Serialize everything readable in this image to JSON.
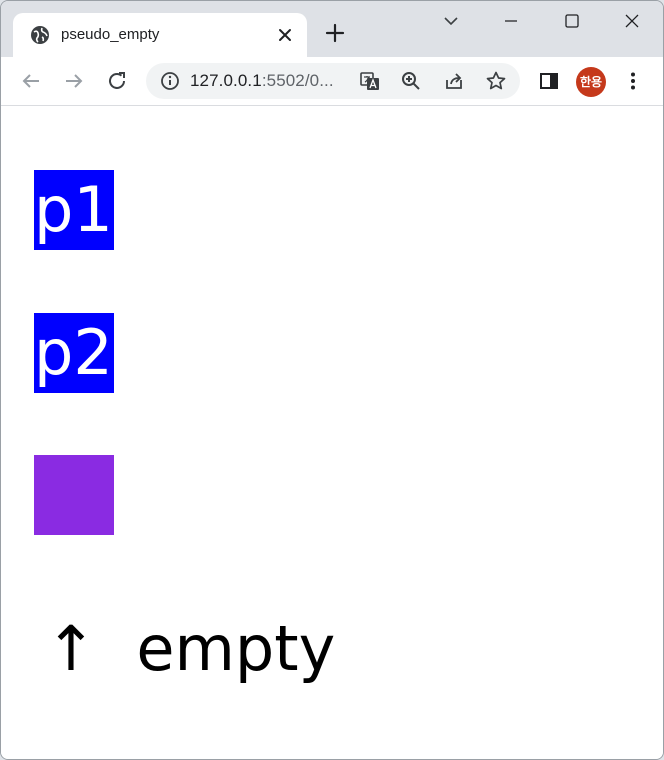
{
  "browser": {
    "tab": {
      "title": "pseudo_empty",
      "favicon": "globe-icon"
    },
    "address": {
      "host": "127.0.0.1",
      "rest": ":5502/0..."
    },
    "profile_label": "한용",
    "icons": {
      "back": "back-arrow-icon",
      "forward": "forward-arrow-icon",
      "reload": "reload-icon",
      "info": "info-icon",
      "translate": "translate-icon",
      "zoom": "zoom-in-icon",
      "share": "share-icon",
      "bookmark": "star-icon",
      "sidepanel": "side-panel-icon",
      "menu": "more-vert-icon"
    }
  },
  "page": {
    "paragraphs": [
      {
        "text": "p1",
        "color": "#0000ff"
      },
      {
        "text": "p2",
        "color": "#0000ff"
      },
      {
        "text": "",
        "color": "#8a2be2"
      }
    ],
    "caption": "↑  empty"
  }
}
